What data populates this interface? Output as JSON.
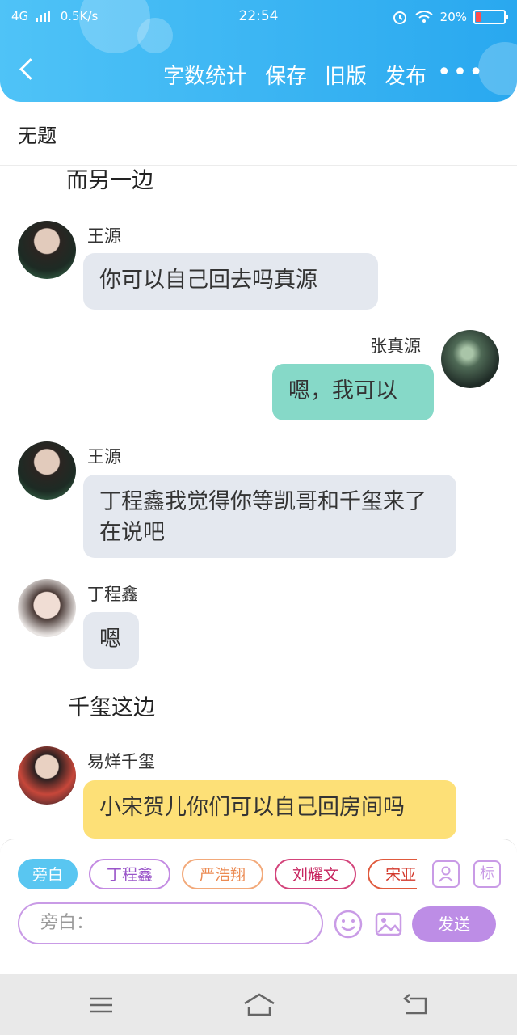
{
  "status_bar": {
    "network": "4G",
    "speed": "0.5K/s",
    "time": "22:54",
    "battery": "20%"
  },
  "header": {
    "nav": [
      "字数统计",
      "保存",
      "旧版",
      "发布"
    ],
    "more": "•••"
  },
  "doc_title": "无题",
  "messages": [
    {
      "type": "narration",
      "text": "而另一边"
    },
    {
      "type": "left",
      "name": "王源",
      "text": "你可以自己回去吗真源"
    },
    {
      "type": "right",
      "name": "张真源",
      "text": "嗯，我可以"
    },
    {
      "type": "left",
      "name": "王源",
      "text": "丁程鑫我觉得你等凯哥和千玺来了在说吧"
    },
    {
      "type": "left",
      "name": "丁程鑫",
      "text": "嗯"
    },
    {
      "type": "narration",
      "text": "千玺这边"
    },
    {
      "type": "left",
      "name": "易烊千玺",
      "text": "小宋贺儿你们可以自己回房间吗"
    }
  ],
  "composer": {
    "chips": [
      "旁白",
      "丁程鑫",
      "严浩翔",
      "刘耀文",
      "宋亚"
    ],
    "role_icon_label": "",
    "tag_icon_label": "标",
    "input_placeholder": "旁白：",
    "send_label": "发送"
  },
  "colors": {
    "header": "#29a8ef",
    "send": "#bd8de6",
    "right_bubble": "#86d9c8",
    "yellow_bubble": "#fde077"
  }
}
